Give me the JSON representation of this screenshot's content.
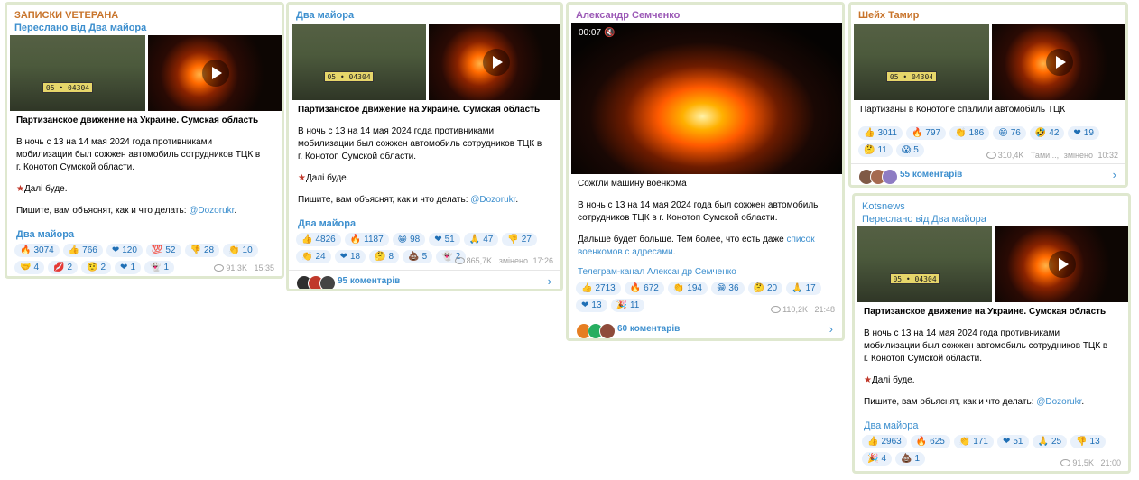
{
  "posts": [
    {
      "channel": "ЗАПИСКИ VETEPAHA",
      "channel_color": "#c8742b",
      "forwarded": "Переслано від Два майора",
      "plate": "05 • 04304",
      "title": "Партизанское движение на Украине. Сумская область",
      "body1": "В ночь с 13 на 14 мая 2024 года противниками мобилизации был сожжен автомобиль сотрудников ТЦК в г. Конотоп Сумской области.",
      "body2": "Далі буде.",
      "body3_prefix": "Пишите, вам объяснят, как и что делать: ",
      "body3_link": "@Dozorukr",
      "body3_suffix": ".",
      "source": "Два майора",
      "reactions": [
        {
          "icon": "flame-icon",
          "glyph": "🔥",
          "count": "3074"
        },
        {
          "icon": "thumbs-up-icon",
          "glyph": "👍",
          "count": "766"
        },
        {
          "icon": "heart-icon",
          "glyph": "❤",
          "count": "120"
        },
        {
          "icon": "hundred-icon",
          "glyph": "💯",
          "count": "52"
        },
        {
          "icon": "thumbs-down-icon",
          "glyph": "👎",
          "count": "28"
        },
        {
          "icon": "clap-icon",
          "glyph": "👏",
          "count": "10"
        },
        {
          "icon": "handshake-icon",
          "glyph": "🤝",
          "count": "4"
        },
        {
          "icon": "lips-icon",
          "glyph": "💋",
          "count": "2"
        },
        {
          "icon": "face-icon",
          "glyph": "🤨",
          "count": "2"
        },
        {
          "icon": "heart-icon",
          "glyph": "❤",
          "count": "1"
        },
        {
          "icon": "ghost-icon",
          "glyph": "👻",
          "count": "1"
        }
      ],
      "views": "91,3K",
      "time": "15:35"
    },
    {
      "channel": "Два майора",
      "channel_color": "#3d8fce",
      "plate": "05 • 04304",
      "title": "Партизанское движение на Украине. Сумская область",
      "body1": "В ночь с 13 на 14 мая 2024 года противниками мобилизации был сожжен автомобиль сотрудников ТЦК в г. Конотоп Сумской области.",
      "body2": "Далі буде.",
      "body3_prefix": "Пишите, вам объяснят, как и что делать: ",
      "body3_link": "@Dozorukr",
      "body3_suffix": ".",
      "source": "Два майора",
      "reactions": [
        {
          "icon": "thumbs-up-icon",
          "glyph": "👍",
          "count": "4826"
        },
        {
          "icon": "flame-icon",
          "glyph": "🔥",
          "count": "1187"
        },
        {
          "icon": "grin-icon",
          "glyph": "😁",
          "count": "98"
        },
        {
          "icon": "heart-icon",
          "glyph": "❤",
          "count": "51"
        },
        {
          "icon": "pray-icon",
          "glyph": "🙏",
          "count": "47"
        },
        {
          "icon": "thumbs-down-icon",
          "glyph": "👎",
          "count": "27"
        },
        {
          "icon": "clap-icon",
          "glyph": "👏",
          "count": "24"
        },
        {
          "icon": "heart-icon",
          "glyph": "❤",
          "count": "18"
        },
        {
          "icon": "thinking-icon",
          "glyph": "🤔",
          "count": "8"
        },
        {
          "icon": "poop-icon",
          "glyph": "💩",
          "count": "5"
        },
        {
          "icon": "ghost-icon",
          "glyph": "👻",
          "count": "2"
        }
      ],
      "views": "865,7K",
      "edited": "змінено",
      "time": "17:26",
      "comments": "95 коментарів"
    },
    {
      "channel": "Александр Семченко",
      "channel_color": "#9b59b6",
      "video_time": "00:07",
      "title": "Сожгли машину военкома",
      "body1": "В ночь с 13 на 14 мая 2024 года был сожжен автомобиль сотрудников ТЦК в г. Конотоп Сумской области.",
      "body2_prefix": "Дальше будет больше. Тем более, что есть даже ",
      "body2_link": "список военкомов с адресами",
      "body2_suffix": ".",
      "source": "Телеграм-канал Александр Семченко",
      "reactions": [
        {
          "icon": "thumbs-up-icon",
          "glyph": "👍",
          "count": "2713"
        },
        {
          "icon": "flame-icon",
          "glyph": "🔥",
          "count": "672"
        },
        {
          "icon": "clap-icon",
          "glyph": "👏",
          "count": "194"
        },
        {
          "icon": "grin-icon",
          "glyph": "😁",
          "count": "36"
        },
        {
          "icon": "thinking-icon",
          "glyph": "🤔",
          "count": "20"
        },
        {
          "icon": "pray-icon",
          "glyph": "🙏",
          "count": "17"
        },
        {
          "icon": "heart-icon",
          "glyph": "❤",
          "count": "13"
        },
        {
          "icon": "party-icon",
          "glyph": "🎉",
          "count": "11"
        }
      ],
      "views": "110,2K",
      "time": "21:48",
      "comments": "60 коментарів"
    },
    {
      "channel": "Шейх Тамир",
      "channel_color": "#c8742b",
      "plate": "05 • 04304",
      "title": "Партизаны в Конотопе спалили автомобиль ТЦК",
      "reactions": [
        {
          "icon": "thumbs-up-icon",
          "glyph": "👍",
          "count": "3011"
        },
        {
          "icon": "flame-icon",
          "glyph": "🔥",
          "count": "797"
        },
        {
          "icon": "clap-icon",
          "glyph": "👏",
          "count": "186"
        },
        {
          "icon": "grin-icon",
          "glyph": "😁",
          "count": "76"
        },
        {
          "icon": "rofl-icon",
          "glyph": "🤣",
          "count": "42"
        },
        {
          "icon": "heart-icon",
          "glyph": "❤",
          "count": "19"
        },
        {
          "icon": "thinking-icon",
          "glyph": "🤔",
          "count": "11"
        },
        {
          "icon": "scream-icon",
          "glyph": "😱",
          "count": "5"
        }
      ],
      "views": "310,4K",
      "author": "Тами...,",
      "edited": "змінено",
      "time": "10:32",
      "comments": "55 коментарів"
    },
    {
      "channel": "Kotsnews",
      "channel_color": "#3d8fce",
      "forwarded": "Переслано від Два майора",
      "plate": "05 • 04304",
      "title": "Партизанское движение на Украине. Сумская область",
      "body1": "В ночь с 13 на 14 мая 2024 года противниками мобилизации был сожжен автомобиль сотрудников ТЦК в г. Конотоп Сумской области.",
      "body2": "Далі буде.",
      "body3_prefix": "Пишите, вам объяснят, как и что делать: ",
      "body3_link": "@Dozorukr",
      "body3_suffix": ".",
      "source": "Два майора",
      "reactions": [
        {
          "icon": "thumbs-up-icon",
          "glyph": "👍",
          "count": "2963"
        },
        {
          "icon": "flame-icon",
          "glyph": "🔥",
          "count": "625"
        },
        {
          "icon": "clap-icon",
          "glyph": "👏",
          "count": "171"
        },
        {
          "icon": "heart-icon",
          "glyph": "❤",
          "count": "51"
        },
        {
          "icon": "pray-icon",
          "glyph": "🙏",
          "count": "25"
        },
        {
          "icon": "thumbs-down-icon",
          "glyph": "👎",
          "count": "13"
        },
        {
          "icon": "party-icon",
          "glyph": "🎉",
          "count": "4"
        },
        {
          "icon": "poop-icon",
          "glyph": "💩",
          "count": "1"
        }
      ],
      "views": "91,5K",
      "time": "21:00"
    }
  ]
}
